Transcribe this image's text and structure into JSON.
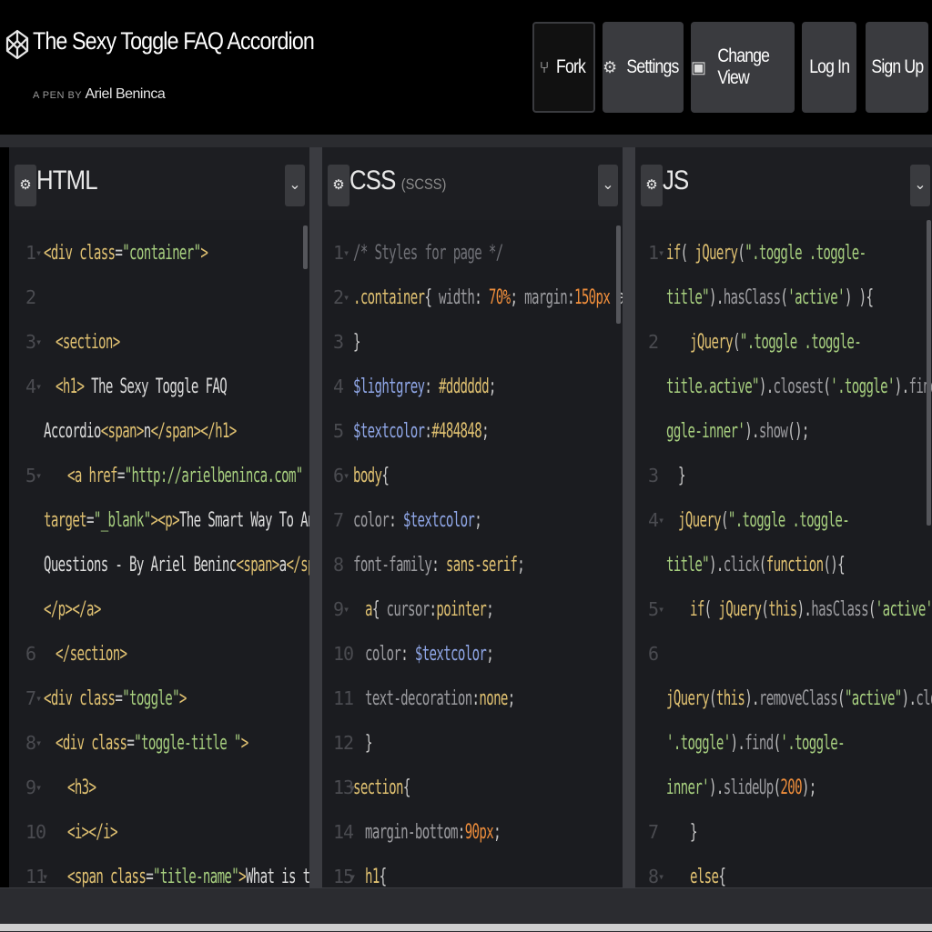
{
  "pen": {
    "title": "The Sexy Toggle FAQ Accordion",
    "by_label": "A PEN BY",
    "author": "Ariel Beninca"
  },
  "header_buttons": [
    {
      "label": "Fork",
      "icon": "fork-icon"
    },
    {
      "label": "Settings",
      "icon": "gear-icon"
    },
    {
      "label": "Change View",
      "icon": "change-view-icon"
    },
    {
      "label": "Log In",
      "icon": ""
    },
    {
      "label": "Sign Up",
      "icon": ""
    }
  ],
  "panels": {
    "html": {
      "title": "HTML",
      "subtitle": ""
    },
    "css": {
      "title": "CSS",
      "subtitle": "(SCSS)"
    },
    "js": {
      "title": "JS",
      "subtitle": ""
    }
  },
  "colors": {
    "tag": "#e0c171",
    "attr": "#e0c171",
    "string": "#a7cf7f",
    "text": "#dcdcdc",
    "punct": "#c8c8c8",
    "comment": "#6f7076",
    "number": "#ee8d3b",
    "variable": "#8fa6e6",
    "selector": "#e0c171",
    "property": "#9c9ca0"
  },
  "html_code": [
    {
      "num": "1",
      "fold": "▾",
      "indent": 0,
      "segs": [
        [
          "<div ",
          "tag"
        ],
        [
          "class",
          "attr"
        ],
        [
          "=",
          "punct"
        ],
        [
          "\"container\"",
          "string"
        ],
        [
          ">",
          "tag"
        ]
      ]
    },
    {
      "num": "2",
      "fold": "",
      "indent": 0,
      "segs": []
    },
    {
      "num": "3",
      "fold": "▾",
      "indent": 1,
      "segs": [
        [
          "<section>",
          "tag"
        ]
      ]
    },
    {
      "num": "4",
      "fold": "▾",
      "indent": 1,
      "segs": [
        [
          "<h1>",
          "tag"
        ],
        [
          " The Sexy Toggle FAQ",
          "text"
        ]
      ]
    },
    {
      "num": "",
      "fold": "",
      "indent": 0,
      "segs": [
        [
          "Accordio",
          "text"
        ],
        [
          "<span>",
          "tag"
        ],
        [
          "n",
          "text"
        ],
        [
          "</span></h1>",
          "tag"
        ]
      ]
    },
    {
      "num": "5",
      "fold": "▾",
      "indent": 2,
      "segs": [
        [
          "<a ",
          "tag"
        ],
        [
          "href",
          "attr"
        ],
        [
          "=",
          "punct"
        ],
        [
          "\"http://arielbeninca.com\"",
          "string"
        ]
      ]
    },
    {
      "num": "",
      "fold": "",
      "indent": 0,
      "segs": [
        [
          "target",
          "attr"
        ],
        [
          "=",
          "punct"
        ],
        [
          "\"_blank\"",
          "string"
        ],
        [
          "><p>",
          "tag"
        ],
        [
          "The Smart Way To Answer",
          "text"
        ]
      ]
    },
    {
      "num": "",
      "fold": "",
      "indent": 0,
      "segs": [
        [
          "Questions - By Ariel Beninc",
          "text"
        ],
        [
          "<span>",
          "tag"
        ],
        [
          "a",
          "text"
        ],
        [
          "</span>",
          "tag"
        ]
      ]
    },
    {
      "num": "",
      "fold": "",
      "indent": 0,
      "segs": [
        [
          "</p></a>",
          "tag"
        ]
      ]
    },
    {
      "num": "6",
      "fold": "",
      "indent": 1,
      "segs": [
        [
          "</section>",
          "tag"
        ]
      ]
    },
    {
      "num": "7",
      "fold": "▾",
      "indent": 0,
      "segs": [
        [
          "<div ",
          "tag"
        ],
        [
          "class",
          "attr"
        ],
        [
          "=",
          "punct"
        ],
        [
          "\"toggle\"",
          "string"
        ],
        [
          ">",
          "tag"
        ]
      ]
    },
    {
      "num": "8",
      "fold": "▾",
      "indent": 1,
      "segs": [
        [
          "<div ",
          "tag"
        ],
        [
          "class",
          "attr"
        ],
        [
          "=",
          "punct"
        ],
        [
          "\"toggle-title \"",
          "string"
        ],
        [
          ">",
          "tag"
        ]
      ]
    },
    {
      "num": "9",
      "fold": "▾",
      "indent": 2,
      "segs": [
        [
          "<h3>",
          "tag"
        ]
      ]
    },
    {
      "num": "10",
      "fold": "",
      "indent": 2,
      "segs": [
        [
          "<i></i>",
          "tag"
        ]
      ]
    },
    {
      "num": "11",
      "fold": "▾",
      "indent": 2,
      "segs": [
        [
          "<span ",
          "tag"
        ],
        [
          "class",
          "attr"
        ],
        [
          "=",
          "punct"
        ],
        [
          "\"title-name\"",
          "string"
        ],
        [
          ">",
          "tag"
        ],
        [
          "What is the",
          "text"
        ]
      ]
    }
  ],
  "css_code": [
    {
      "num": "1",
      "fold": "▾",
      "indent": 0,
      "segs": [
        [
          "/* Styles for page */",
          "comment"
        ]
      ]
    },
    {
      "num": "2",
      "fold": "▾",
      "indent": 0,
      "segs": [
        [
          ".container",
          "selector"
        ],
        [
          "{ ",
          "punct"
        ],
        [
          "width",
          "property"
        ],
        [
          ": ",
          "punct"
        ],
        [
          "70%",
          "number"
        ],
        [
          "; ",
          "punct"
        ],
        [
          "margin",
          "property"
        ],
        [
          ":",
          "punct"
        ],
        [
          "150px",
          "number"
        ],
        [
          " auto;",
          "punct"
        ]
      ]
    },
    {
      "num": "3",
      "fold": "",
      "indent": 0,
      "segs": [
        [
          "}",
          "punct"
        ]
      ]
    },
    {
      "num": "4",
      "fold": "",
      "indent": 0,
      "segs": [
        [
          "$lightgrey",
          "variable"
        ],
        [
          ": ",
          "punct"
        ],
        [
          "#dddddd",
          "selector"
        ],
        [
          ";",
          "punct"
        ]
      ]
    },
    {
      "num": "5",
      "fold": "",
      "indent": 0,
      "segs": [
        [
          "$textcolor",
          "variable"
        ],
        [
          ":",
          "punct"
        ],
        [
          "#484848",
          "selector"
        ],
        [
          ";",
          "punct"
        ]
      ]
    },
    {
      "num": "6",
      "fold": "▾",
      "indent": 0,
      "segs": [
        [
          "body",
          "selector"
        ],
        [
          "{",
          "punct"
        ]
      ]
    },
    {
      "num": "7",
      "fold": "",
      "indent": 0,
      "segs": [
        [
          "color",
          "property"
        ],
        [
          ": ",
          "punct"
        ],
        [
          "$textcolor",
          "variable"
        ],
        [
          ";",
          "punct"
        ]
      ]
    },
    {
      "num": "8",
      "fold": "",
      "indent": 0,
      "segs": [
        [
          "font-family",
          "property"
        ],
        [
          ": ",
          "punct"
        ],
        [
          "sans-serif",
          "selector"
        ],
        [
          ";",
          "punct"
        ]
      ]
    },
    {
      "num": "9",
      "fold": "▾",
      "indent": 1,
      "segs": [
        [
          "a",
          "selector"
        ],
        [
          "{ ",
          "punct"
        ],
        [
          "cursor",
          "property"
        ],
        [
          ":",
          "punct"
        ],
        [
          "pointer",
          "selector"
        ],
        [
          ";",
          "punct"
        ]
      ]
    },
    {
      "num": "10",
      "fold": "",
      "indent": 1,
      "segs": [
        [
          "color",
          "property"
        ],
        [
          ": ",
          "punct"
        ],
        [
          "$textcolor",
          "variable"
        ],
        [
          ";",
          "punct"
        ]
      ]
    },
    {
      "num": "11",
      "fold": "",
      "indent": 1,
      "segs": [
        [
          "text-decoration",
          "property"
        ],
        [
          ":",
          "punct"
        ],
        [
          "none",
          "selector"
        ],
        [
          ";",
          "punct"
        ]
      ]
    },
    {
      "num": "12",
      "fold": "",
      "indent": 1,
      "segs": [
        [
          "}",
          "punct"
        ]
      ]
    },
    {
      "num": "13",
      "fold": "▾",
      "indent": 0,
      "segs": [
        [
          "section",
          "selector"
        ],
        [
          "{",
          "punct"
        ]
      ]
    },
    {
      "num": "14",
      "fold": "",
      "indent": 1,
      "segs": [
        [
          "margin-bottom",
          "property"
        ],
        [
          ":",
          "punct"
        ],
        [
          "90px",
          "number"
        ],
        [
          ";",
          "punct"
        ]
      ]
    },
    {
      "num": "15",
      "fold": "▾",
      "indent": 1,
      "segs": [
        [
          "h1",
          "selector"
        ],
        [
          "{",
          "punct"
        ]
      ]
    }
  ],
  "js_code": [
    {
      "num": "1",
      "fold": "▾",
      "indent": 0,
      "segs": [
        [
          "if",
          "selector"
        ],
        [
          "( ",
          "punct"
        ],
        [
          "jQuery",
          "selector"
        ],
        [
          "(",
          "punct"
        ],
        [
          "\".toggle .toggle-",
          "string"
        ]
      ]
    },
    {
      "num": "",
      "fold": "",
      "indent": 0,
      "segs": [
        [
          "title\"",
          "string"
        ],
        [
          ").",
          "punct"
        ],
        [
          "hasClass",
          "property"
        ],
        [
          "(",
          "punct"
        ],
        [
          "'active'",
          "string"
        ],
        [
          ") ){",
          "punct"
        ]
      ]
    },
    {
      "num": "2",
      "fold": "",
      "indent": 2,
      "segs": [
        [
          "jQuery",
          "selector"
        ],
        [
          "(",
          "punct"
        ],
        [
          "\".toggle .toggle-",
          "string"
        ]
      ]
    },
    {
      "num": "",
      "fold": "",
      "indent": 0,
      "segs": [
        [
          "title.active\"",
          "string"
        ],
        [
          ").",
          "punct"
        ],
        [
          "closest",
          "property"
        ],
        [
          "(",
          "punct"
        ],
        [
          "'.toggle'",
          "string"
        ],
        [
          ").",
          "punct"
        ],
        [
          "find",
          "property"
        ],
        [
          "('.to",
          "string"
        ]
      ]
    },
    {
      "num": "",
      "fold": "",
      "indent": 0,
      "segs": [
        [
          "ggle-inner'",
          "string"
        ],
        [
          ").",
          "punct"
        ],
        [
          "show",
          "property"
        ],
        [
          "();",
          "punct"
        ]
      ]
    },
    {
      "num": "3",
      "fold": "",
      "indent": 1,
      "segs": [
        [
          "}",
          "punct"
        ]
      ]
    },
    {
      "num": "4",
      "fold": "▾",
      "indent": 1,
      "segs": [
        [
          "jQuery",
          "selector"
        ],
        [
          "(",
          "punct"
        ],
        [
          "\".toggle .toggle-",
          "string"
        ]
      ]
    },
    {
      "num": "",
      "fold": "",
      "indent": 0,
      "segs": [
        [
          "title\"",
          "string"
        ],
        [
          ").",
          "punct"
        ],
        [
          "click",
          "property"
        ],
        [
          "(",
          "punct"
        ],
        [
          "function",
          "selector"
        ],
        [
          "(){",
          "punct"
        ]
      ]
    },
    {
      "num": "5",
      "fold": "▾",
      "indent": 2,
      "segs": [
        [
          "if",
          "selector"
        ],
        [
          "( ",
          "punct"
        ],
        [
          "jQuery",
          "selector"
        ],
        [
          "(",
          "punct"
        ],
        [
          "this",
          "selector"
        ],
        [
          ").",
          "punct"
        ],
        [
          "hasClass",
          "property"
        ],
        [
          "(",
          "punct"
        ],
        [
          "'active'",
          "string"
        ],
        [
          ") ){",
          "punct"
        ]
      ]
    },
    {
      "num": "6",
      "fold": "",
      "indent": 0,
      "segs": []
    },
    {
      "num": "",
      "fold": "",
      "indent": 0,
      "segs": [
        [
          "jQuery",
          "selector"
        ],
        [
          "(",
          "punct"
        ],
        [
          "this",
          "selector"
        ],
        [
          ").",
          "punct"
        ],
        [
          "removeClass",
          "property"
        ],
        [
          "(",
          "punct"
        ],
        [
          "\"active\"",
          "string"
        ],
        [
          ").",
          "punct"
        ],
        [
          "closest",
          "property"
        ],
        [
          "(",
          "punct"
        ]
      ]
    },
    {
      "num": "",
      "fold": "",
      "indent": 0,
      "segs": [
        [
          "'.toggle'",
          "string"
        ],
        [
          ").",
          "punct"
        ],
        [
          "find",
          "property"
        ],
        [
          "(",
          "punct"
        ],
        [
          "'.toggle-",
          "string"
        ]
      ]
    },
    {
      "num": "",
      "fold": "",
      "indent": 0,
      "segs": [
        [
          "inner'",
          "string"
        ],
        [
          ").",
          "punct"
        ],
        [
          "slideUp",
          "property"
        ],
        [
          "(",
          "punct"
        ],
        [
          "200",
          "number"
        ],
        [
          ");",
          "punct"
        ]
      ]
    },
    {
      "num": "7",
      "fold": "",
      "indent": 2,
      "segs": [
        [
          "}",
          "punct"
        ]
      ]
    },
    {
      "num": "8",
      "fold": "▾",
      "indent": 2,
      "segs": [
        [
          "else",
          "selector"
        ],
        [
          "{",
          "punct"
        ]
      ]
    }
  ]
}
